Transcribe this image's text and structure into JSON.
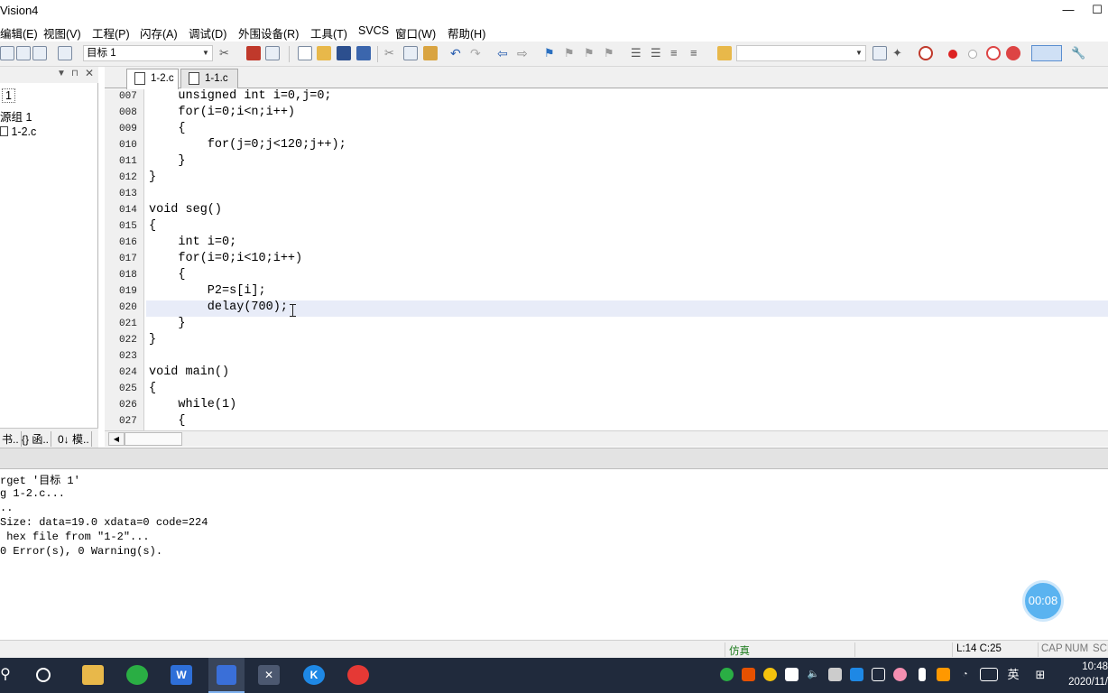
{
  "window": {
    "title": "Vision4",
    "minimize_glyph": "—",
    "maximize_glyph": "☐"
  },
  "menu": {
    "items": [
      "编辑(E)",
      "视图(V)",
      "工程(P)",
      "闪存(A)",
      "调试(D)",
      "外围设备(R)",
      "工具(T)",
      "SVCS",
      "窗口(W)",
      "帮助(H)"
    ]
  },
  "toolbar": {
    "target_combo": "目标 1",
    "find_combo": ""
  },
  "project": {
    "tree": [
      "1",
      "源组 1",
      "1-2.c"
    ],
    "bottom_tabs": [
      "书..",
      "{} 函..",
      "0↓ 模.."
    ]
  },
  "editor": {
    "tabs": [
      {
        "label": "1-2.c",
        "active": true
      },
      {
        "label": "1-1.c",
        "active": false
      }
    ],
    "lines": [
      {
        "n": "007",
        "code": "    unsigned int i=0,j=0;"
      },
      {
        "n": "008",
        "code": "    for(i=0;i<n;i++)"
      },
      {
        "n": "009",
        "code": "    {"
      },
      {
        "n": "010",
        "code": "        for(j=0;j<120;j++);"
      },
      {
        "n": "011",
        "code": "    }"
      },
      {
        "n": "012",
        "code": "}"
      },
      {
        "n": "013",
        "code": ""
      },
      {
        "n": "014",
        "code": "void seg()"
      },
      {
        "n": "015",
        "code": "{"
      },
      {
        "n": "016",
        "code": "    int i=0;"
      },
      {
        "n": "017",
        "code": "    for(i=0;i<10;i++)"
      },
      {
        "n": "018",
        "code": "    {"
      },
      {
        "n": "019",
        "code": "        P2=s[i];"
      },
      {
        "n": "020",
        "code": "        delay(700);"
      },
      {
        "n": "021",
        "code": "    }"
      },
      {
        "n": "022",
        "code": "}"
      },
      {
        "n": "023",
        "code": ""
      },
      {
        "n": "024",
        "code": "void main()"
      },
      {
        "n": "025",
        "code": "{"
      },
      {
        "n": "026",
        "code": "    while(1)"
      },
      {
        "n": "027",
        "code": "    {"
      }
    ]
  },
  "output": {
    "lines": [
      "rget '目标 1'",
      "g 1-2.c...",
      "..",
      "Size: data=19.0 xdata=0 code=224",
      " hex file from \"1-2\"...",
      "0 Error(s), 0 Warning(s)."
    ]
  },
  "recording_timer": "00:08",
  "statusbar": {
    "mode": "仿真",
    "position": "L:14 C:25",
    "cap": "CAP",
    "num": "NUM",
    "scrl": "SCR"
  },
  "taskbar": {
    "ime": "英",
    "time": "10:48",
    "date": "2020/11/"
  },
  "colors": {
    "line_highlight": "#e8ecf8",
    "taskbar": "#202a3c",
    "timer": "#5ab3f0"
  }
}
